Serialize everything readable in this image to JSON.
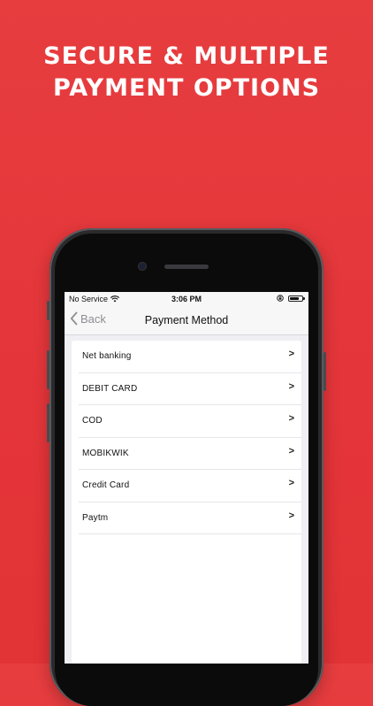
{
  "headline": {
    "line1": "SECURE & MULTIPLE",
    "line2": "PAYMENT OPTIONS"
  },
  "status_bar": {
    "carrier": "No Service",
    "time": "3:06 PM",
    "battery_level": 0.75
  },
  "nav": {
    "back_label": "Back",
    "title": "Payment Method"
  },
  "payment_methods": [
    {
      "label": "Net banking",
      "chevron": ">"
    },
    {
      "label": "DEBIT CARD",
      "chevron": ">"
    },
    {
      "label": "COD",
      "chevron": ">"
    },
    {
      "label": "MOBIKWIK",
      "chevron": ">"
    },
    {
      "label": "Credit Card",
      "chevron": ">"
    },
    {
      "label": "Paytm",
      "chevron": ">"
    }
  ],
  "colors": {
    "background": "#e63a3d",
    "phone_frame": "#2a2a2c",
    "screen_bg": "#efeff4",
    "back_tint": "#8e8e93"
  },
  "icons": {
    "wifi": "wifi-icon",
    "orientation_lock": "lock-icon",
    "battery": "battery-icon",
    "back": "chevron-left-icon"
  }
}
